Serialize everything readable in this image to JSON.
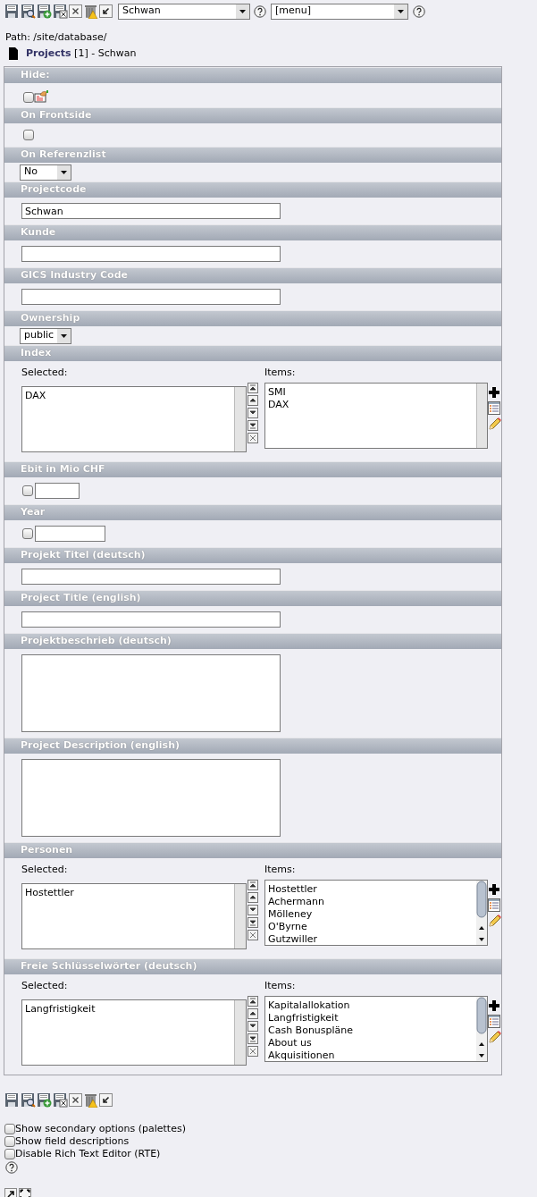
{
  "toolbar": {
    "record_select": {
      "value": "Schwan"
    },
    "menu_select": {
      "value": "[menu]"
    }
  },
  "path": "Path: /site/database/",
  "record": {
    "table": "Projects",
    "title": "[1] - Schwan"
  },
  "fields": [
    {
      "kind": "checkbox_icon",
      "label": "Hide:",
      "checked": false
    },
    {
      "kind": "checkbox",
      "label": "On Frontside",
      "checked": false
    },
    {
      "kind": "select",
      "label": "On Referenzlist",
      "value": "No"
    },
    {
      "kind": "input",
      "label": "Projectcode",
      "value": "Schwan"
    },
    {
      "kind": "input",
      "label": "Kunde"
    },
    {
      "kind": "input",
      "label": "GICS Industry Code"
    },
    {
      "kind": "select",
      "label": "Ownership",
      "value": "public"
    },
    {
      "kind": "multiselect",
      "label": "Index",
      "selected_label": "Selected:",
      "items_label": "Items:",
      "selected": [
        "DAX"
      ],
      "items": [
        "SMI",
        "DAX"
      ]
    },
    {
      "kind": "checkbox_input",
      "label": "Ebit in Mio CHF",
      "checked": false
    },
    {
      "kind": "checkbox_input_wide",
      "label": "Year",
      "checked": false
    },
    {
      "kind": "input",
      "label": "Projekt Titel (deutsch)"
    },
    {
      "kind": "input",
      "label": "Project Title (english)"
    },
    {
      "kind": "textarea",
      "label": "Projektbeschrieb (deutsch)"
    },
    {
      "kind": "textarea",
      "label": "Project Description (english)"
    },
    {
      "kind": "multiselect",
      "label": "Personen",
      "selected_label": "Selected:",
      "items_label": "Items:",
      "selected": [
        "Hostettler"
      ],
      "items": [
        "Hostettler",
        "Achermann",
        "Mölleney",
        "O'Byrne",
        "Gutzwiller"
      ]
    },
    {
      "kind": "multiselect",
      "label": "Freie Schlüsselwörter (deutsch)",
      "selected_label": "Selected:",
      "items_label": "Items:",
      "selected": [
        "Langfristigkeit"
      ],
      "items": [
        "Kapitalallokation",
        "Langfristigkeit",
        "Cash Bonuspläne",
        "About us",
        "Akquisitionen"
      ]
    }
  ],
  "options": [
    {
      "label": "Show secondary options (palettes)",
      "checked": false
    },
    {
      "label": "Show field descriptions",
      "checked": false
    },
    {
      "label": "Disable Rich Text Editor (RTE)",
      "checked": false
    }
  ]
}
